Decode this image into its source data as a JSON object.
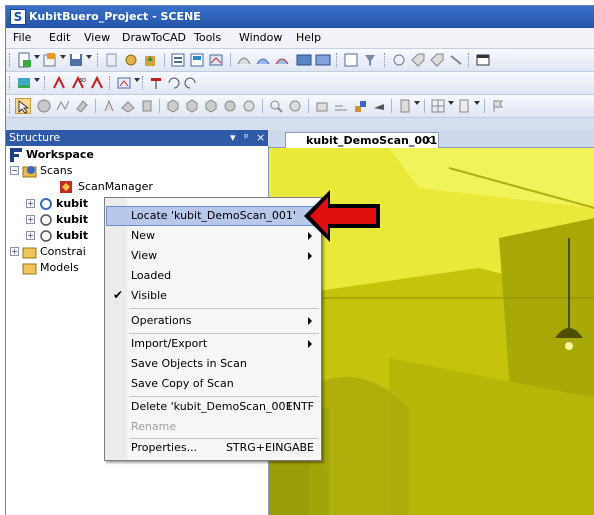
{
  "window": {
    "title": "KubitBuero_Project - SCENE",
    "app_icon_letter": "S"
  },
  "menu": [
    "File",
    "Edit",
    "View",
    "DrawToCAD",
    "Tools",
    "Window",
    "Help"
  ],
  "structure_panel": {
    "title": "Structure",
    "controls": {
      "dropdown": "▾",
      "pin": "ᵖ",
      "close": "×"
    }
  },
  "tree": {
    "workspace": "Workspace",
    "scans": "Scans",
    "scan_manager": "ScanManager",
    "scan_items": [
      "kubit",
      "kubit",
      "kubit"
    ],
    "constraints": "Constrai",
    "models": "Models"
  },
  "document_tab": {
    "label": "kubit_DemoScan_001",
    "close": "x"
  },
  "context_menu": {
    "items": [
      {
        "label": "Locate 'kubit_DemoScan_001'",
        "highlighted": true
      },
      {
        "label": "New",
        "submenu": true
      },
      {
        "label": "View",
        "submenu": true
      },
      {
        "label": "Loaded"
      },
      {
        "label": "Visible",
        "checked": true
      },
      {
        "label": "Operations",
        "submenu": true
      },
      {
        "label": "Import/Export",
        "submenu": true
      },
      {
        "label": "Save Objects in Scan"
      },
      {
        "label": "Save Copy of Scan"
      },
      {
        "label": "Delete 'kubit_DemoScan_001'",
        "shortcut": "ENTF"
      },
      {
        "label": "Rename",
        "disabled": true
      },
      {
        "label": "Properties...",
        "shortcut": "STRG+EINGABE"
      }
    ]
  },
  "colors": {
    "title_bar": "#2454a8",
    "panel_header": "#2f5aa8",
    "scan_yellow": "#cfcf12",
    "arrow_red": "#e01010",
    "menu_highlight": "#b8c8ea"
  }
}
